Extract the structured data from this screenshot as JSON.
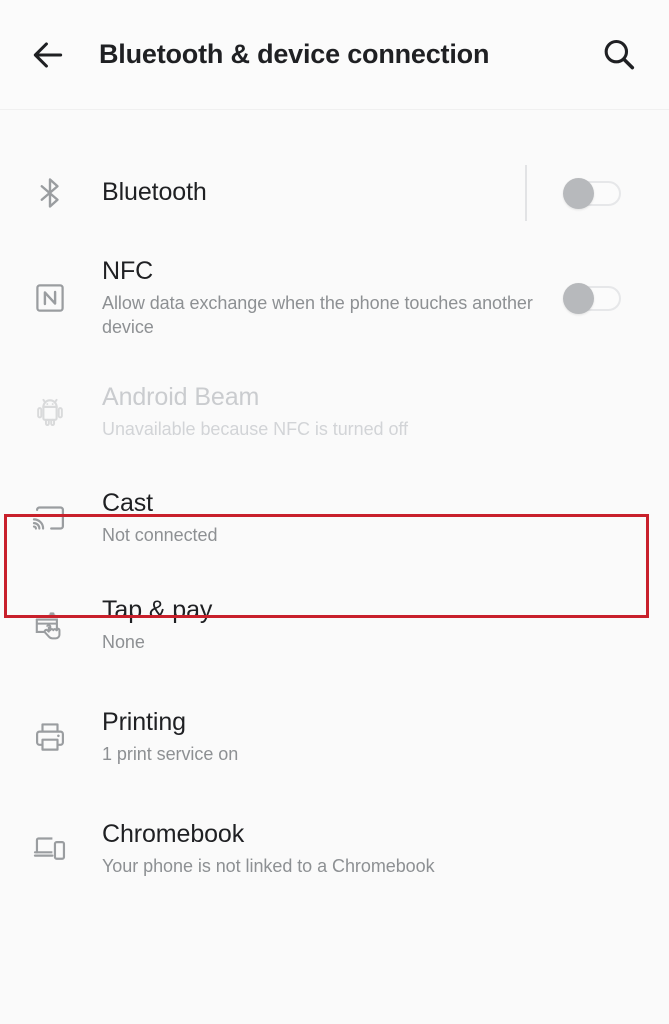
{
  "header": {
    "back_icon": "arrow-left-icon",
    "title": "Bluetooth & device connection",
    "search_icon": "search-icon"
  },
  "colors": {
    "background": "#fafafa",
    "title_text": "#1f2023",
    "subtitle_text": "#8d9093",
    "disabled_text": "#cacccf",
    "icon": "#9a9da0",
    "annotation": "#c8202b",
    "toggle_knob_off": "#b7b9bc"
  },
  "annotation": {
    "shape": "rectangle",
    "target": "Cast",
    "color": "#c8202b"
  },
  "rows": [
    {
      "key": "bluetooth",
      "icon": "bluetooth-icon",
      "title": "Bluetooth",
      "subtitle": "",
      "toggle": "off",
      "has_divider": true,
      "disabled": false
    },
    {
      "key": "nfc",
      "icon": "nfc-icon",
      "title": "NFC",
      "subtitle": "Allow data exchange when the phone touches another device",
      "toggle": "off",
      "has_divider": false,
      "disabled": false
    },
    {
      "key": "android-beam",
      "icon": "android-robot-icon",
      "title": "Android Beam",
      "subtitle": "Unavailable because NFC is turned off",
      "toggle": "none",
      "has_divider": false,
      "disabled": true
    },
    {
      "key": "cast",
      "icon": "cast-icon",
      "title": "Cast",
      "subtitle": "Not connected",
      "toggle": "none",
      "has_divider": false,
      "disabled": false
    },
    {
      "key": "tap-and-pay",
      "icon": "tap-and-pay-icon",
      "title": "Tap & pay",
      "subtitle": "None",
      "toggle": "none",
      "has_divider": false,
      "disabled": false
    },
    {
      "key": "printing",
      "icon": "printer-icon",
      "title": "Printing",
      "subtitle": "1 print service on",
      "toggle": "none",
      "has_divider": false,
      "disabled": false
    },
    {
      "key": "chromebook",
      "icon": "chromebook-icon",
      "title": "Chromebook",
      "subtitle": "Your phone is not linked to a Chromebook",
      "toggle": "none",
      "has_divider": false,
      "disabled": false
    }
  ]
}
